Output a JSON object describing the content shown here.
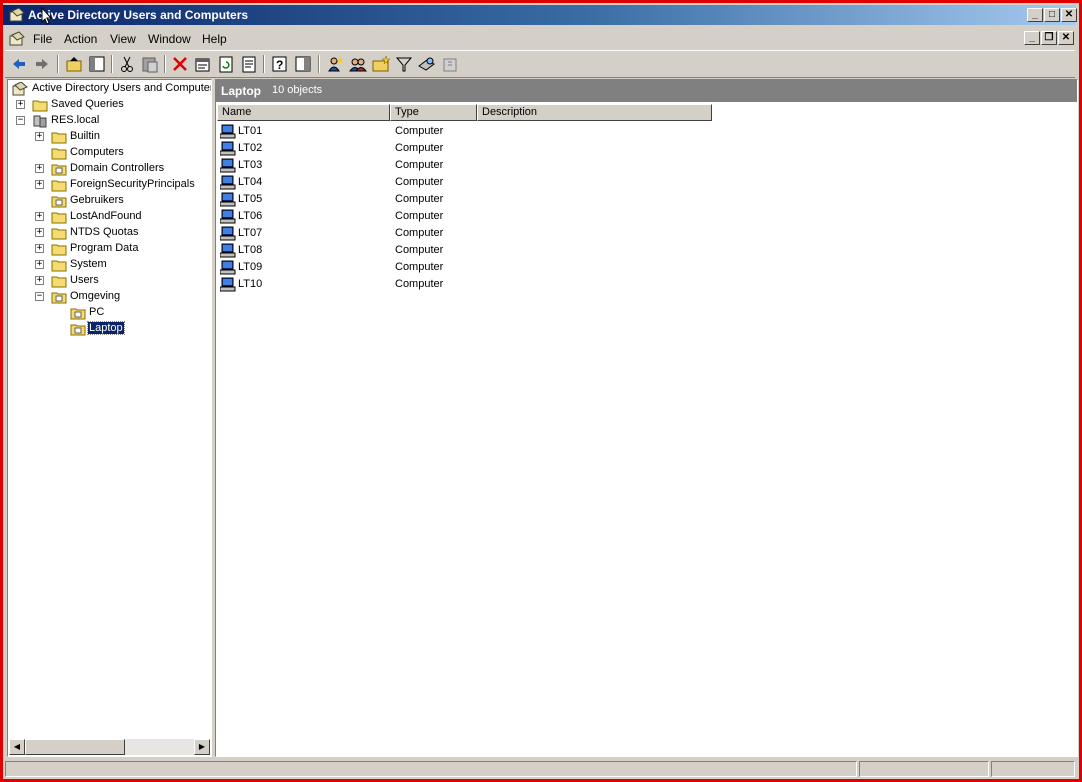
{
  "window": {
    "title": "Active Directory Users and Computers",
    "icon": "aduc-icon"
  },
  "menu": [
    "File",
    "Action",
    "View",
    "Window",
    "Help"
  ],
  "tree": {
    "root": "Active Directory Users and Computer",
    "saved_queries": "Saved Queries",
    "domain": "RES.local",
    "children": [
      "Builtin",
      "Computers",
      "Domain Controllers",
      "ForeignSecurityPrincipals",
      "Gebruikers",
      "LostAndFound",
      "NTDS Quotas",
      "Program Data",
      "System",
      "Users",
      "Omgeving"
    ],
    "omgeving_children": [
      "PC",
      "Laptop"
    ],
    "selected": "Laptop"
  },
  "pane": {
    "title": "Laptop",
    "count": "10 objects",
    "columns": [
      "Name",
      "Type",
      "Description"
    ],
    "rows": [
      {
        "name": "LT01",
        "type": "Computer"
      },
      {
        "name": "LT02",
        "type": "Computer"
      },
      {
        "name": "LT03",
        "type": "Computer"
      },
      {
        "name": "LT04",
        "type": "Computer"
      },
      {
        "name": "LT05",
        "type": "Computer"
      },
      {
        "name": "LT06",
        "type": "Computer"
      },
      {
        "name": "LT07",
        "type": "Computer"
      },
      {
        "name": "LT08",
        "type": "Computer"
      },
      {
        "name": "LT09",
        "type": "Computer"
      },
      {
        "name": "LT10",
        "type": "Computer"
      }
    ]
  },
  "colors": {
    "title_start": "#0a246a",
    "title_end": "#a6caf0",
    "border": "#e00000",
    "selection": "#0a246a",
    "pane_header": "#808080"
  }
}
